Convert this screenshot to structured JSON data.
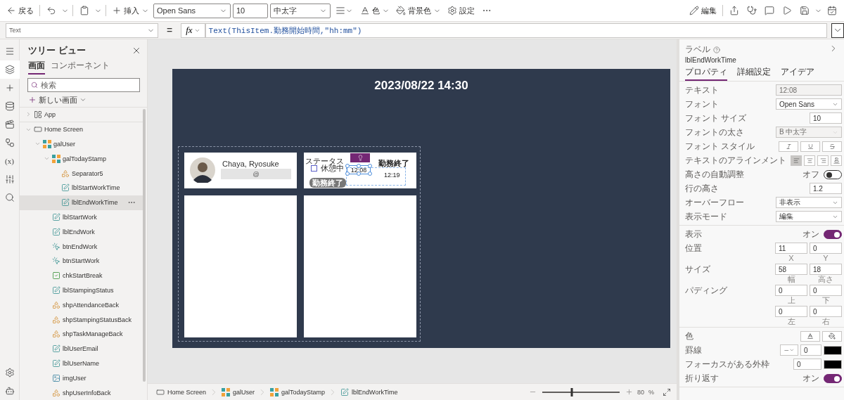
{
  "toolbar": {
    "back": "戻る",
    "insert": "挿入",
    "font": "Open Sans",
    "font_size": "10",
    "font_weight": "中太字",
    "text_color_label": "色",
    "fill": "背景色",
    "settings": "設定",
    "edit": "編集"
  },
  "formula_bar": {
    "property": "Text",
    "equals": "=",
    "fx": "fx",
    "formula": "Text(ThisItem.勤務開始時間,\"hh:mm\")"
  },
  "rail": {
    "variables": "(x)"
  },
  "tree_view": {
    "title": "ツリー ビュー",
    "tabs": [
      {
        "label": "画面",
        "selected": true
      },
      {
        "label": "コンポーネント",
        "selected": false
      }
    ],
    "search": {
      "placeholder": "検索"
    },
    "new_screen": "新しい画面",
    "items": [
      {
        "kind": "app",
        "name": "App",
        "expanded": false,
        "selected": false
      },
      {
        "kind": "screen",
        "name": "Home Screen",
        "expanded": true,
        "selected": false,
        "children": [
          {
            "kind": "gallery",
            "name": "galUser",
            "expanded": true,
            "selected": false,
            "children": [
              {
                "kind": "gallery",
                "name": "galTodayStamp",
                "expanded": true,
                "selected": false,
                "children": [
                  {
                    "kind": "shape",
                    "name": "Separator5",
                    "selected": false
                  },
                  {
                    "kind": "label",
                    "name": "lblStartWorkTime",
                    "selected": false
                  },
                  {
                    "kind": "label",
                    "name": "lblEndWorkTime",
                    "selected": true
                  }
                ]
              },
              {
                "kind": "label",
                "name": "lblStartWork",
                "selected": false
              },
              {
                "kind": "label",
                "name": "lblEndWork",
                "selected": false
              },
              {
                "kind": "button",
                "name": "btnEndWork",
                "selected": false
              },
              {
                "kind": "button",
                "name": "btnStartWork",
                "selected": false
              },
              {
                "kind": "checkbox",
                "name": "chkStartBreak",
                "selected": false
              },
              {
                "kind": "label",
                "name": "lblStampingStatus",
                "selected": false
              },
              {
                "kind": "shape",
                "name": "shpAttendanceBack",
                "selected": false
              },
              {
                "kind": "shape",
                "name": "shpStampingStatusBack",
                "selected": false
              },
              {
                "kind": "shape",
                "name": "shpTaskManageBack",
                "selected": false
              },
              {
                "kind": "label",
                "name": "lblUserEmail",
                "selected": false
              },
              {
                "kind": "label",
                "name": "lblUserName",
                "selected": false
              },
              {
                "kind": "image",
                "name": "imgUser",
                "selected": false
              },
              {
                "kind": "shape",
                "name": "shpUserInfoBack",
                "selected": false
              }
            ]
          }
        ]
      }
    ]
  },
  "app_screen": {
    "title": "2023/08/22 14:30",
    "user_card": {
      "name": "Chaya, Ryosuke",
      "email_mark": "@"
    },
    "status_card": {
      "heading": "ステータス",
      "break_checkbox": {
        "label": "休憩中",
        "checked": false
      },
      "end_button": "勤務終了",
      "end_header": "勤務終了",
      "start_time": "12:08",
      "end_time": "12:19"
    }
  },
  "properties": {
    "type": "ラベル",
    "name": "lblEndWorkTime",
    "tabs": [
      {
        "label": "プロパティ",
        "selected": true
      },
      {
        "label": "詳細設定",
        "selected": false
      },
      {
        "label": "アイデア",
        "selected": false
      }
    ],
    "sections": [
      [
        {
          "kind": "input",
          "label": "テキスト",
          "value": "12:08",
          "disabled": true
        },
        {
          "kind": "select",
          "label": "フォント",
          "value": "Open Sans",
          "disabled": false
        },
        {
          "kind": "number",
          "label": "フォント サイズ",
          "value": "10"
        },
        {
          "kind": "select",
          "label": "フォントの太さ",
          "value": "B 中太字",
          "disabled": true
        },
        {
          "kind": "font_style",
          "label": "フォント スタイル"
        },
        {
          "kind": "align",
          "label": "テキストのアラインメント",
          "options": [
            {
              "selected": true
            },
            {
              "selected": false
            },
            {
              "selected": false
            },
            {
              "selected": false
            }
          ]
        },
        {
          "kind": "toggle",
          "label": "高さの自動調整",
          "state_text": "オフ",
          "on": false
        },
        {
          "kind": "number",
          "label": "行の高さ",
          "value": "1.2"
        },
        {
          "kind": "select",
          "label": "オーバーフロー",
          "value": "非表示",
          "disabled": false
        },
        {
          "kind": "select",
          "label": "表示モード",
          "value": "編集",
          "disabled": false
        }
      ],
      [
        {
          "kind": "toggle",
          "label": "表示",
          "state_text": "オン",
          "on": true
        },
        {
          "kind": "pair",
          "label": "位置",
          "fields": [
            {
              "value": "11",
              "caption": "X"
            },
            {
              "value": "0",
              "caption": "Y"
            }
          ]
        },
        {
          "kind": "pair",
          "label": "サイズ",
          "fields": [
            {
              "value": "58",
              "caption": "幅"
            },
            {
              "value": "18",
              "caption": "高さ"
            }
          ]
        },
        {
          "kind": "pair",
          "label": "パディング",
          "fields": [
            {
              "value": "0",
              "caption": "上"
            },
            {
              "value": "0",
              "caption": "下"
            }
          ]
        },
        {
          "kind": "pair",
          "fields": [
            {
              "value": "0",
              "caption": "左"
            },
            {
              "value": "0",
              "caption": "右"
            }
          ]
        }
      ],
      [
        {
          "kind": "color",
          "label": "色"
        },
        {
          "kind": "border",
          "label": "罫線",
          "value": "0"
        },
        {
          "kind": "focus_border",
          "label": "フォーカスがある外枠",
          "value": "0"
        },
        {
          "kind": "toggle",
          "label": "折り返す",
          "state_text": "オン",
          "on": true
        }
      ]
    ]
  },
  "status_bar": {
    "breadcrumb": [
      {
        "kind": "screen",
        "name": "Home Screen"
      },
      {
        "kind": "gallery",
        "name": "galUser"
      },
      {
        "kind": "gallery",
        "name": "galTodayStamp"
      },
      {
        "kind": "label",
        "name": "lblEndWorkTime"
      }
    ],
    "zoom": {
      "level": 0.38,
      "value": "80",
      "unit": "%"
    }
  }
}
